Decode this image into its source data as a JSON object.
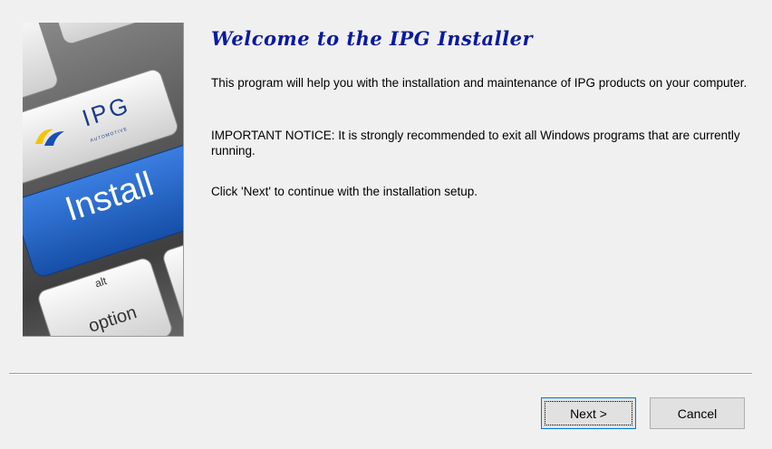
{
  "wizard": {
    "title": "Welcome to the IPG Installer",
    "paragraph_1": "This program will help you with the installation and maintenance of IPG products on your computer.",
    "paragraph_2": "IMPORTANT NOTICE: It is strongly recommended to exit all Windows programs that are currently running.",
    "paragraph_3": "Click 'Next' to continue with the installation setup."
  },
  "side_image": {
    "logo_text": "IPG",
    "logo_subtext": "AUTOMOTIVE",
    "install_key_label": "Install",
    "alt_key_label": "alt",
    "option_key_label": "option"
  },
  "buttons": {
    "next_label": "Next >",
    "cancel_label": "Cancel"
  },
  "colors": {
    "title": "#0a1a9e",
    "install_key": "#1f5fc4",
    "dialog_background": "#f0f0f0"
  }
}
